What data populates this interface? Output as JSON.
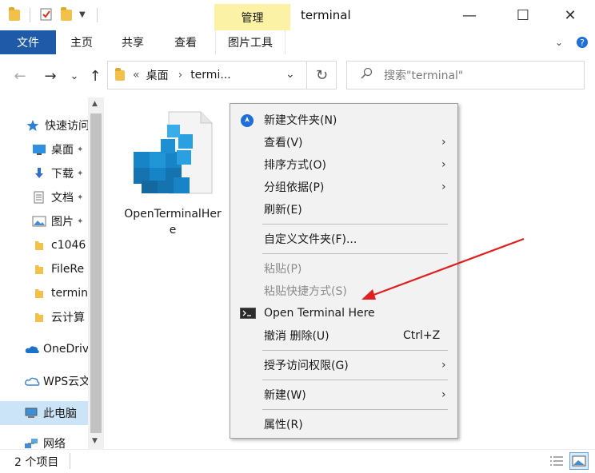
{
  "titlebar": {
    "manage_tab": "管理",
    "title": "terminal",
    "minimize": "—",
    "maximize": "☐",
    "close": "✕"
  },
  "ribbon": {
    "file": "文件",
    "home": "主页",
    "share": "共享",
    "view": "查看",
    "picture_tools": "图片工具"
  },
  "address": {
    "back": "←",
    "forward": "→",
    "recent": "⌄",
    "up": "↑",
    "chevrons": "«",
    "crumb1": "桌面",
    "crumb_sep": "›",
    "crumb2": "termi...",
    "dropdown": "⌄",
    "refresh": "↻",
    "search_placeholder": "搜索\"terminal\""
  },
  "nav": {
    "items": [
      {
        "label": "快速访问",
        "icon": "star-icon"
      },
      {
        "label": "桌面",
        "icon": "desktop-icon",
        "pinned": true
      },
      {
        "label": "下载",
        "icon": "download-icon",
        "pinned": true
      },
      {
        "label": "文档",
        "icon": "document-icon",
        "pinned": true
      },
      {
        "label": "图片",
        "icon": "picture-icon",
        "pinned": true
      },
      {
        "label": "c1046",
        "icon": "folder-icon"
      },
      {
        "label": "FileRe",
        "icon": "folder-icon"
      },
      {
        "label": "termin",
        "icon": "folder-icon"
      },
      {
        "label": "云计算",
        "icon": "folder-icon"
      },
      {
        "label": "OneDriv",
        "icon": "onedrive-icon"
      },
      {
        "label": "WPS云文",
        "icon": "cloud-icon"
      },
      {
        "label": "此电脑",
        "icon": "computer-icon"
      },
      {
        "label": "网络",
        "icon": "network-icon"
      }
    ],
    "pin_glyph": "📌"
  },
  "content": {
    "file_name": "OpenTerminalHere"
  },
  "status": {
    "count": "2 个项目"
  },
  "context_menu": {
    "new_folder": "新建文件夹(N)",
    "view": "查看(V)",
    "sort": "排序方式(O)",
    "group": "分组依据(P)",
    "refresh": "刷新(E)",
    "customize": "自定义文件夹(F)...",
    "paste": "粘贴(P)",
    "paste_shortcut": "粘贴快捷方式(S)",
    "open_terminal": "Open Terminal Here",
    "undo_delete": "撤消 删除(U)",
    "undo_shortcut": "Ctrl+Z",
    "give_access": "授予访问权限(G)",
    "new": "新建(W)",
    "properties": "属性(R)",
    "submenu_arrow": "›"
  },
  "colors": {
    "file_tab": "#1e5aa8",
    "manage_tab": "#fbf2a5",
    "selection": "#cce4f7",
    "menu_bg": "#f2f2f2",
    "annotation_arrow": "#e02020"
  }
}
